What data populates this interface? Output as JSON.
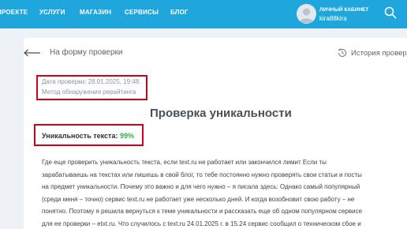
{
  "nav": {
    "items": [
      "ПРОЕКТЕ",
      "УСЛУГИ",
      "МАГАЗИН",
      "СЕРВИСЫ",
      "БЛОГ"
    ]
  },
  "account": {
    "label": "ЛИЧНЫЙ КАБИНЕТ",
    "username": "kira88kira"
  },
  "back_link": "На форму проверки",
  "history_link": "История проверок",
  "check": {
    "date": "Дата проверки: 28.01.2025, 19:48.",
    "method": "Метод обнаружения рерайтинга"
  },
  "page_title": "Проверка уникальности",
  "uniqueness": {
    "label": "Уникальность текста:",
    "value": "99%"
  },
  "text_lines": [
    "Где еще проверить уникальность текста, если text.ru не работает или закончился лимит Если ты",
    "зарабатываешь на текстах или пишешь в свой блог, то тебе постоянно нужно проверять свои статьи и посты",
    "на предмет уникальности. Почему это важно и для чего нужно – я писала здесь: Однако самый популярный",
    "(среди меня – точно) сервис text.ru не работает уже несколько дней. И когда возобновит свою работу – не",
    "понятно. Поэтому я решила вернуться к теме уникальности и рассказать еще об одном популярном сервисе",
    "для ее проверки – etxt.ru. Что случилось с text.ru 24.01.2025 г. в 15.24 сервис сообщил о техническом сбое и"
  ],
  "colors": {
    "header": "#1fa7dd",
    "highlight_border": "#d0021b",
    "uniqueness_value": "#2fb34b"
  }
}
